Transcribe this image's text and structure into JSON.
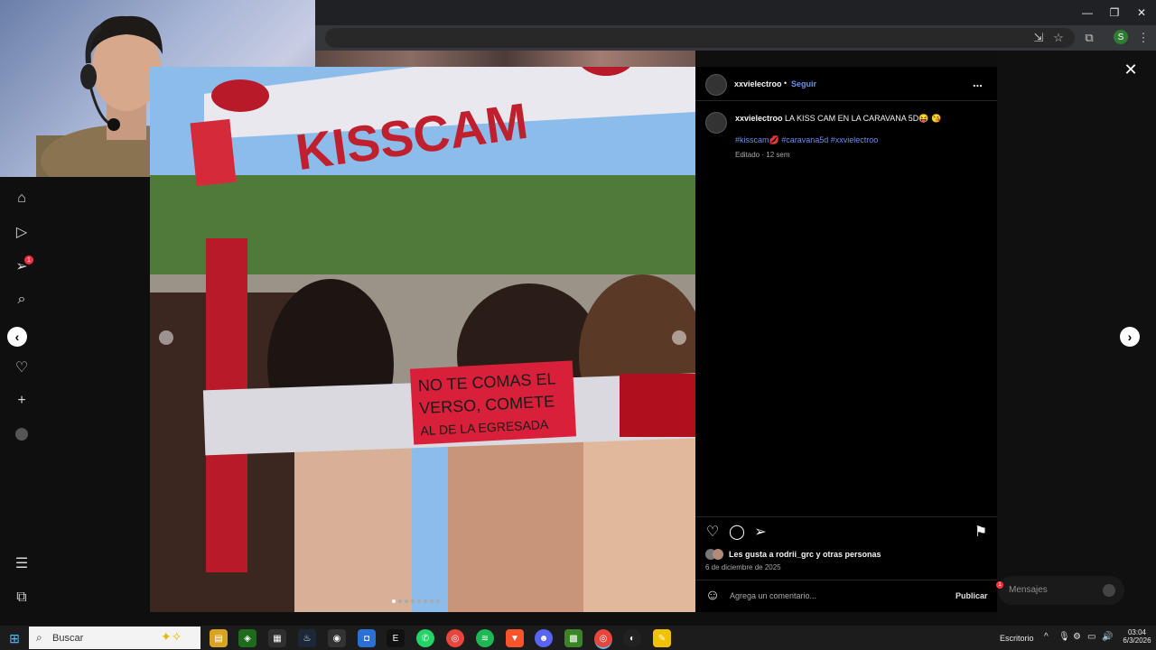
{
  "window": {
    "minimize": "—",
    "restore": "❐",
    "close": "✕"
  },
  "toolbar": {
    "profile_initial": "S"
  },
  "post": {
    "username": "xxvielectroo",
    "separator": "•",
    "follow": "Seguir",
    "more": "...",
    "caption_user": "xxvielectroo",
    "caption_text": "LA KISS CAM EN LA CARAVANA 5D😝 😘",
    "hashtags": "#kisscam💋 #caravana5d #xxvielectroo",
    "edited": "Editado · 12 sem",
    "likes": "Les gusta a rodrii_grc y otras personas",
    "date": "6 de diciembre de 2025",
    "comment_placeholder": "Agrega un comentario...",
    "publish": "Publicar"
  },
  "photo": {
    "banner_text": "KISSCAM",
    "sign_line1": "NO TE COMAS EL",
    "sign_line2": "VERSO, COMETE",
    "sign_line3": "AL DE LA EGRESADA"
  },
  "sidebar": {
    "notification_count": "1"
  },
  "messages": {
    "label": "Mensajes",
    "badge": "1"
  },
  "taskbar": {
    "search_label": "Buscar",
    "desktop_label": "Escritorio",
    "time": "03:04",
    "date": "6/3/2026"
  }
}
